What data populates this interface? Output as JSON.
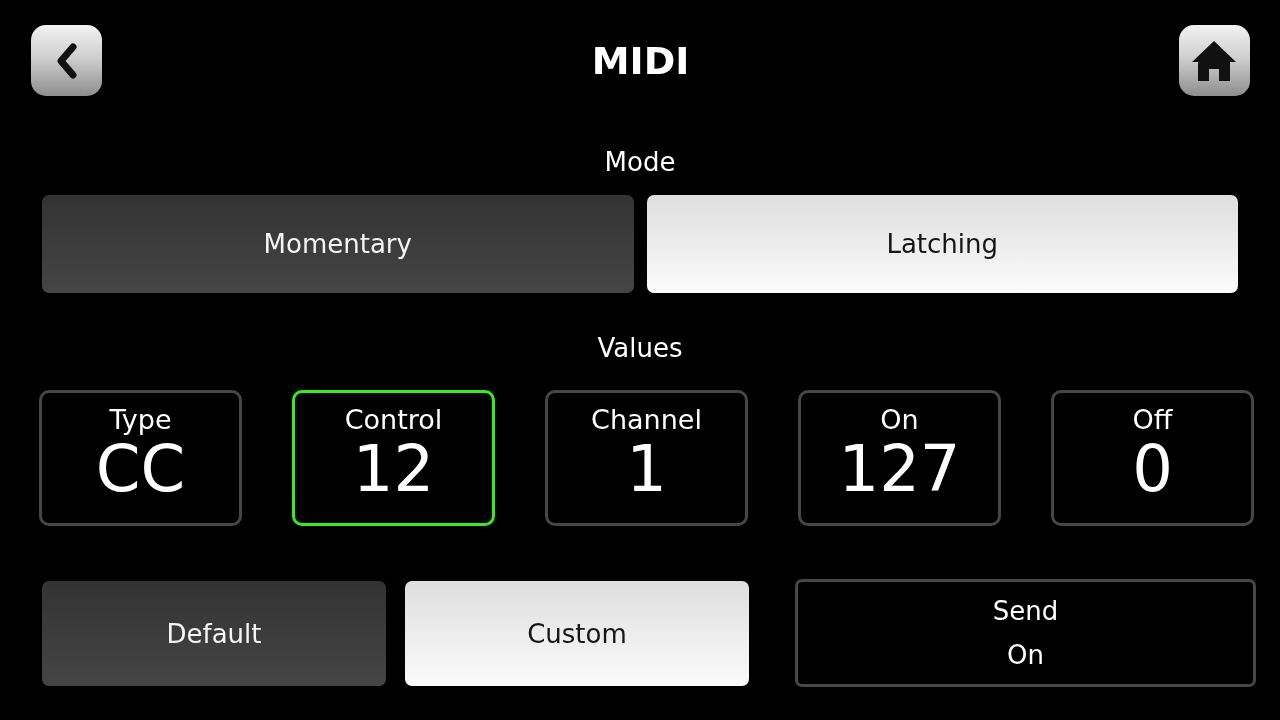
{
  "header": {
    "title": "MIDI"
  },
  "mode": {
    "label": "Mode",
    "options": [
      {
        "label": "Momentary",
        "selected": false
      },
      {
        "label": "Latching",
        "selected": true
      }
    ]
  },
  "values": {
    "label": "Values",
    "fields": [
      {
        "label": "Type",
        "value": "CC",
        "selected": false
      },
      {
        "label": "Control",
        "value": "12",
        "selected": true
      },
      {
        "label": "Channel",
        "value": "1",
        "selected": false
      },
      {
        "label": "On",
        "value": "127",
        "selected": false
      },
      {
        "label": "Off",
        "value": "0",
        "selected": false
      }
    ]
  },
  "preset": {
    "options": [
      {
        "label": "Default",
        "selected": false
      },
      {
        "label": "Custom",
        "selected": true
      }
    ]
  },
  "send": {
    "label": "Send",
    "state": "On"
  }
}
